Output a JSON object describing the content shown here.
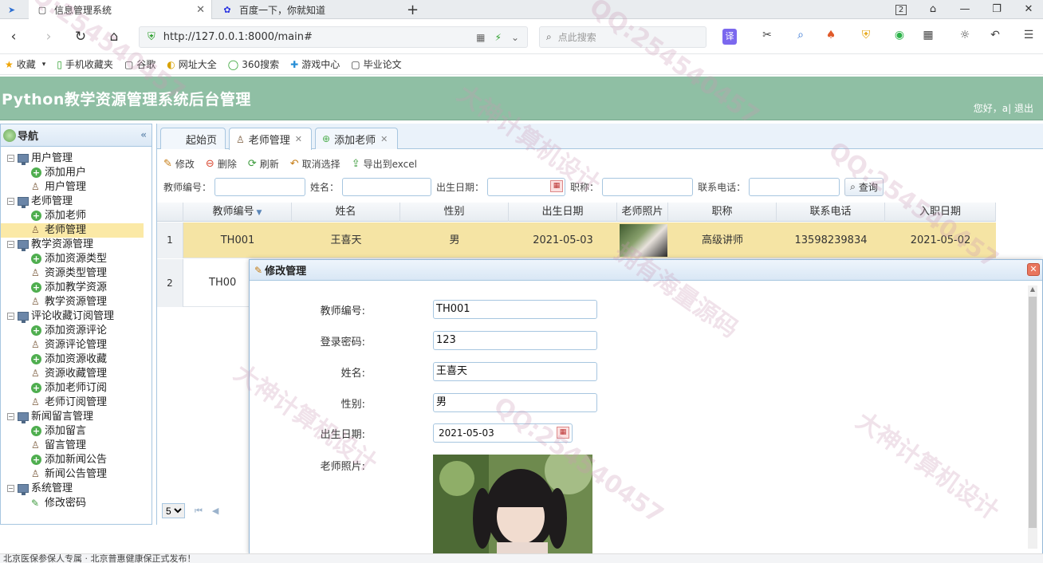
{
  "browser": {
    "tabs": [
      {
        "title": "信息管理系统",
        "active": true
      },
      {
        "title": "百度一下，你就知道",
        "active": false
      }
    ],
    "new_tab": "+",
    "tab_count": "2",
    "url": "http://127.0.0.1:8000/main#",
    "search_placeholder": "点此搜索",
    "bookmarks": [
      "收藏",
      "手机收藏夹",
      "谷歌",
      "网址大全",
      "360搜索",
      "游戏中心",
      "毕业论文"
    ]
  },
  "app": {
    "title": "Python教学资源管理系统后台管理",
    "user_greeting": "您好，a| 退出"
  },
  "sidebar": {
    "title": "导航",
    "groups": [
      {
        "label": "用户管理",
        "items": [
          {
            "label": "添加用户",
            "icon": "add"
          },
          {
            "label": "用户管理",
            "icon": "person"
          }
        ]
      },
      {
        "label": "老师管理",
        "items": [
          {
            "label": "添加老师",
            "icon": "add"
          },
          {
            "label": "老师管理",
            "icon": "person",
            "selected": true
          }
        ]
      },
      {
        "label": "教学资源管理",
        "items": [
          {
            "label": "添加资源类型",
            "icon": "add"
          },
          {
            "label": "资源类型管理",
            "icon": "person"
          },
          {
            "label": "添加教学资源",
            "icon": "add"
          },
          {
            "label": "教学资源管理",
            "icon": "person"
          }
        ]
      },
      {
        "label": "评论收藏订阅管理",
        "items": [
          {
            "label": "添加资源评论",
            "icon": "add"
          },
          {
            "label": "资源评论管理",
            "icon": "person"
          },
          {
            "label": "添加资源收藏",
            "icon": "add"
          },
          {
            "label": "资源收藏管理",
            "icon": "person"
          },
          {
            "label": "添加老师订阅",
            "icon": "add"
          },
          {
            "label": "老师订阅管理",
            "icon": "person"
          }
        ]
      },
      {
        "label": "新闻留言管理",
        "items": [
          {
            "label": "添加留言",
            "icon": "add"
          },
          {
            "label": "留言管理",
            "icon": "person"
          },
          {
            "label": "添加新闻公告",
            "icon": "add"
          },
          {
            "label": "新闻公告管理",
            "icon": "person"
          }
        ]
      },
      {
        "label": "系统管理",
        "items": [
          {
            "label": "修改密码",
            "icon": "pen"
          }
        ]
      }
    ]
  },
  "tabs": [
    {
      "label": "起始页",
      "closable": false
    },
    {
      "label": "老师管理",
      "closable": true,
      "active": true
    },
    {
      "label": "添加老师",
      "closable": true
    }
  ],
  "toolbar": {
    "edit": "修改",
    "delete": "删除",
    "refresh": "刷新",
    "unselect": "取消选择",
    "export": "导出到excel"
  },
  "filters": {
    "teacher_no": "教师编号：",
    "name": "姓名：",
    "birth": "出生日期：",
    "title": "职称：",
    "phone": "联系电话：",
    "query": "查询"
  },
  "grid": {
    "columns": [
      "教师编号",
      "姓名",
      "性别",
      "出生日期",
      "老师照片",
      "职称",
      "联系电话",
      "入职日期"
    ],
    "rows": [
      {
        "no": "1",
        "id": "TH001",
        "name": "王喜天",
        "gender": "男",
        "birth": "2021-05-03",
        "title": "高级讲师",
        "phone": "13598239834",
        "join": "2021-05-02"
      },
      {
        "no": "2",
        "id": "TH00"
      }
    ],
    "page_size": "5"
  },
  "dialog": {
    "title": "修改管理",
    "fields": [
      {
        "label": "教师编号:",
        "value": "TH001"
      },
      {
        "label": "登录密码:",
        "value": "123"
      },
      {
        "label": "姓名:",
        "value": "王喜天"
      },
      {
        "label": "性别:",
        "value": "男"
      },
      {
        "label": "出生日期:",
        "value": "2021-05-03"
      },
      {
        "label": "老师照片:",
        "value": ""
      }
    ]
  },
  "statusbar": {
    "text": "北京医保参保人专属 · 北京普惠健康保正式发布！"
  },
  "colors": {
    "header": "#8fbfa4",
    "highlight_row": "#f5e4a4",
    "border": "#a7c6e0"
  }
}
